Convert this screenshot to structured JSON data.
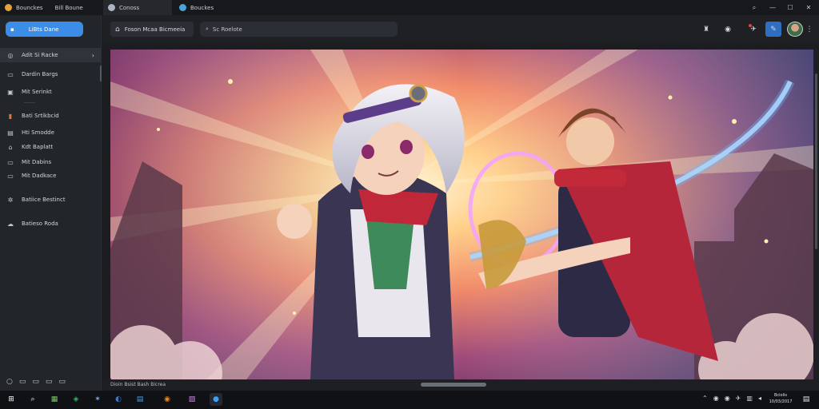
{
  "tabs": [
    {
      "label": "Bounckes",
      "sub": "Bill Boune",
      "active": false
    },
    {
      "label": "Conoss",
      "active": true
    },
    {
      "label": "Bouckes",
      "active": false
    }
  ],
  "sidebar": {
    "new_button": "LiBts Dane",
    "items": [
      {
        "label": "Adit Si Racke",
        "icon": "compass-icon"
      },
      {
        "label": "Dardin Bargs",
        "icon": "card-icon"
      },
      {
        "label": "Mit Serinkt",
        "icon": "monitor-icon"
      },
      {
        "label": "Bati Srtikbcid",
        "icon": "folder-icon"
      },
      {
        "label": "Hti Smodde",
        "icon": "book-icon"
      },
      {
        "label": "Kdt Baplatt",
        "icon": "box-icon"
      },
      {
        "label": "Mit Dabins",
        "icon": "toggle-icon"
      },
      {
        "label": "Mit Dadkace",
        "icon": "toggle-icon"
      },
      {
        "label": "Batiice Bestinct",
        "icon": "settings-icon"
      },
      {
        "label": "Batieso Roda",
        "icon": "cloud-icon"
      }
    ],
    "bottom_icons": [
      "circle-icon",
      "image-icon",
      "gallery-icon",
      "grid-icon",
      "layers-icon"
    ]
  },
  "toolbar": {
    "breadcrumb": "Foson Mcaa Bicmeeia",
    "search_text": "Sc Roelote",
    "icons": [
      "gift-icon",
      "chat-icon",
      "notify-icon",
      "edit-icon",
      "avatar",
      "more-icon"
    ]
  },
  "status": {
    "left": "Dioin Bsist Bash Bicrea"
  },
  "taskbar": {
    "clock_time": "Bciolis",
    "clock_date": "10/03/2017"
  },
  "colors": {
    "accent": "#3b8de8",
    "sidebar_bg": "#22252a",
    "taskbar_bg": "#101114"
  }
}
